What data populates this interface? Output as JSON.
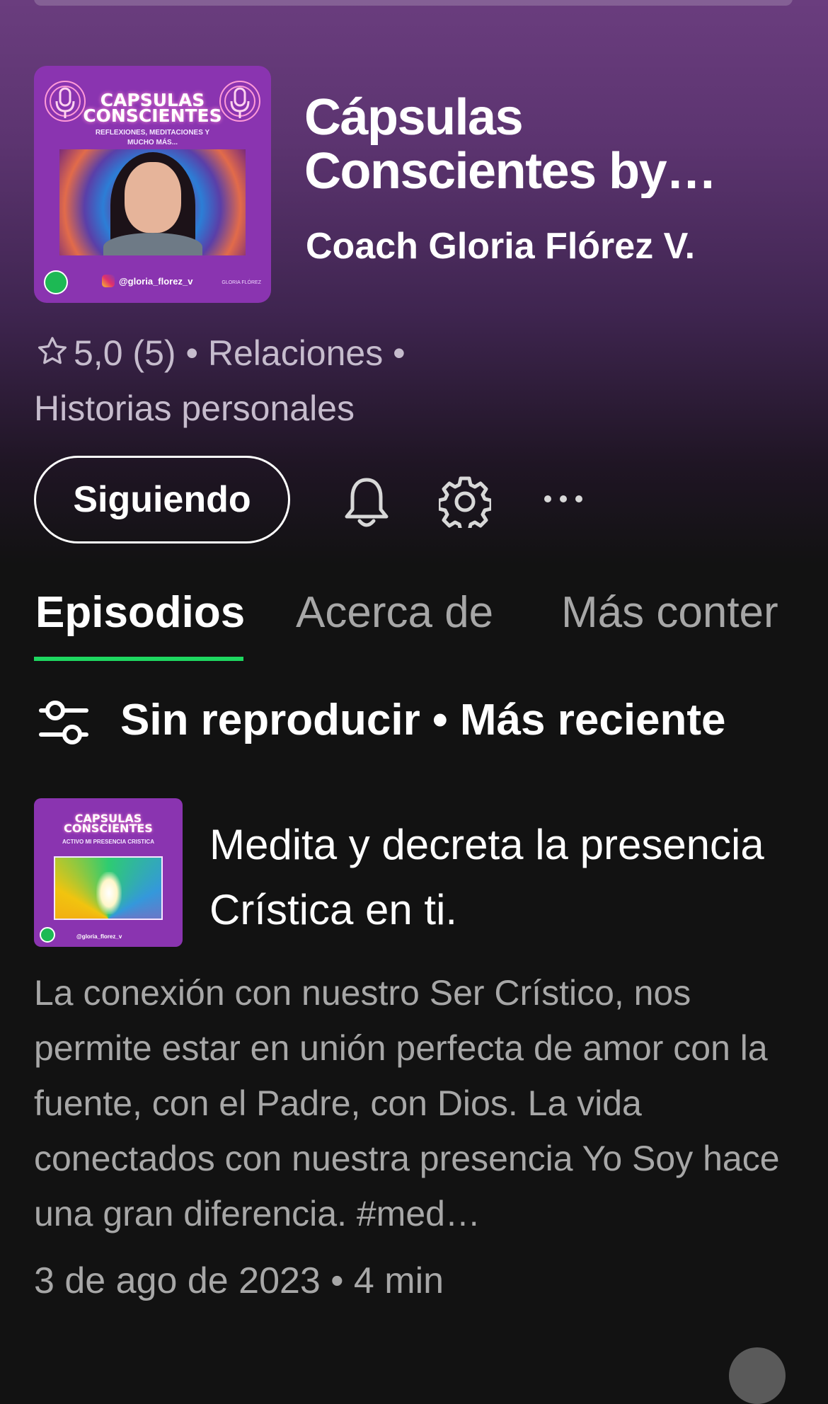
{
  "podcast": {
    "title": "Cápsulas Conscientes by Gloria Flórez V.",
    "author": "Coach Gloria Flórez V.",
    "rating": "5,0",
    "rating_count": "(5)",
    "category_line_1": "Relaciones •",
    "category_line_2": "Historias personales",
    "cover": {
      "title_line_1": "CAPSULAS",
      "title_line_2": "CONSCIENTES",
      "subtitle": "REFLEXIONES, MEDITACIONES Y MUCHO MÁS...",
      "handle": "@gloria_florez_v",
      "brand": "GLORIA FLÓREZ"
    }
  },
  "actions": {
    "follow_label": "Siguiendo"
  },
  "tabs": [
    {
      "label": "Episodios",
      "active": true
    },
    {
      "label": "Acerca de",
      "active": false
    },
    {
      "label": "Más conter",
      "active": false
    }
  ],
  "filter": {
    "label": "Sin reproducir • Más reciente"
  },
  "episode": {
    "title": "Medita y decreta la presencia Crística en ti.",
    "description": "La conexión con nuestro Ser Crístico, nos permite estar en unión perfecta de amor con la fuente, con el Padre, con Dios. La vida conectados con nuestra presencia Yo Soy hace una gran diferencia.  #med…",
    "meta": "3 de ago de 2023 • 4 min",
    "cover": {
      "title_line_1": "CAPSULAS",
      "title_line_2": "CONSCIENTES",
      "subtitle": "ACTIVO MI PRESENCIA CRISTICA",
      "handle": "@gloria_florez_v"
    }
  },
  "colors": {
    "accent": "#1ed760",
    "background": "#121212",
    "hero_top": "#6a3d7e",
    "cover_purple": "#8a34b0",
    "secondary_text": "#a7a7a7"
  }
}
